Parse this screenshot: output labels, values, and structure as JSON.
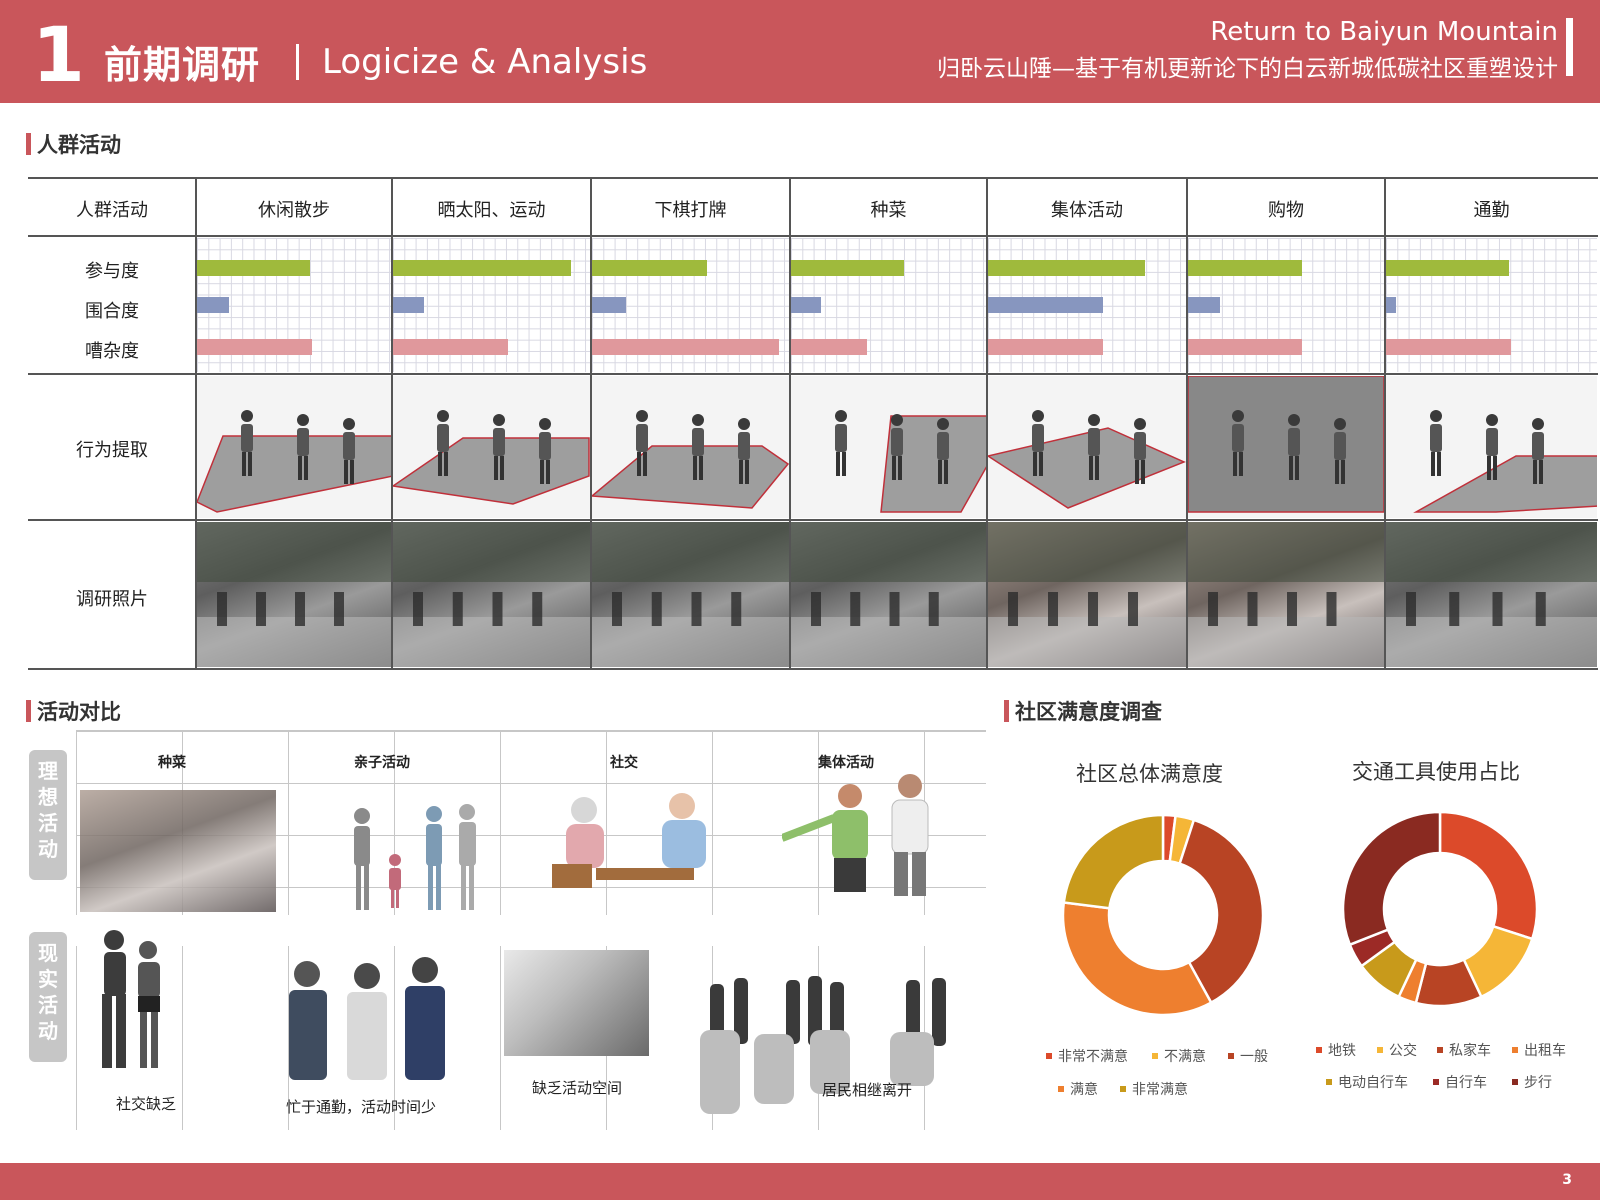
{
  "header": {
    "number": "1",
    "title": "前期调研",
    "subtitle": "Logicize & Analysis",
    "project_en": "Return to Baiyun Mountain",
    "project_cn": "归卧云山陲—基于有机更新论下的白云新城低碳社区重塑设计"
  },
  "sections": {
    "crowd": "人群活动",
    "compare": "活动对比",
    "survey": "社区满意度调查"
  },
  "table": {
    "corner": "人群活动",
    "columns": [
      "休闲散步",
      "晒太阳、运动",
      "下棋打牌",
      "种菜",
      "集体活动",
      "购物",
      "通勤"
    ],
    "metrics": [
      "参与度",
      "围合度",
      "嘈杂度"
    ],
    "row_behavior": "行为提取",
    "row_photos": "调研照片",
    "metric_colors": [
      "#9fba3c",
      "#8796bf",
      "#e0989c"
    ],
    "values": {
      "参与度": [
        0.6,
        0.93,
        0.6,
        0.6,
        0.82,
        0.6,
        0.6
      ],
      "围合度": [
        0.17,
        0.16,
        0.18,
        0.16,
        0.6,
        0.17,
        0.05
      ],
      "嘈杂度": [
        0.61,
        0.6,
        0.98,
        0.4,
        0.6,
        0.6,
        0.61
      ]
    }
  },
  "compare": {
    "ideal_tag": [
      "理",
      "想",
      "活",
      "动"
    ],
    "real_tag": [
      "现",
      "实",
      "活",
      "动"
    ],
    "ideal_labels": [
      "种菜",
      "亲子活动",
      "社交",
      "集体活动"
    ],
    "real_captions": [
      "社交缺乏",
      "忙于通勤，活动时间少",
      "缺乏活动空间",
      "居民相继离开"
    ]
  },
  "chart_data": [
    {
      "type": "pie",
      "title": "社区总体满意度",
      "categories": [
        "非常不满意",
        "不满意",
        "一般",
        "满意",
        "非常满意"
      ],
      "values": [
        2,
        3,
        37,
        35,
        23
      ],
      "colors": [
        "#dc4a2a",
        "#f5b637",
        "#b84424",
        "#ee7f2f",
        "#c89a1b"
      ]
    },
    {
      "type": "pie",
      "title": "交通工具使用占比",
      "categories": [
        "地铁",
        "公交",
        "私家车",
        "出租车",
        "电动自行车",
        "自行车",
        "步行"
      ],
      "values": [
        30,
        13,
        11,
        3,
        8,
        4,
        31
      ],
      "colors": [
        "#dc4a2a",
        "#f5b637",
        "#b84424",
        "#ee7f2f",
        "#c89a1b",
        "#9c2a26",
        "#8a2a21"
      ]
    }
  ],
  "page_number": "3"
}
